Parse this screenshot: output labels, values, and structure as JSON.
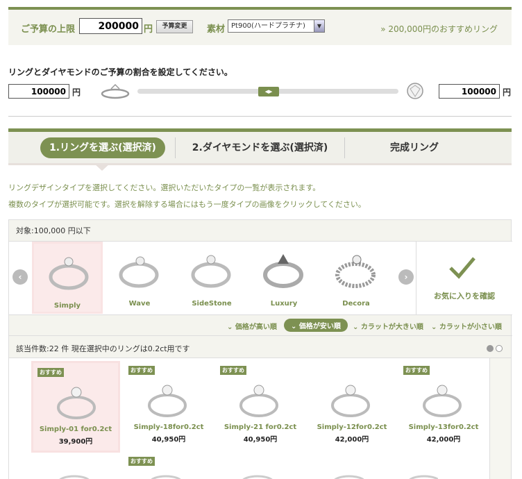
{
  "budget": {
    "label": "ご予算の上限",
    "value": "200000",
    "yen": "円",
    "change_button": "予算変更",
    "material_label": "素材",
    "material_value": "Pt900(ハードプラチナ)",
    "recommend_link": "» 200,000円のおすすめリング"
  },
  "ratio": {
    "title": "リングとダイヤモンドのご予算の割合を設定してください。",
    "ring_amount": "100000",
    "diamond_amount": "100000",
    "yen": "円",
    "ring_share_percent": 50
  },
  "steps": [
    {
      "label": "1.リングを選ぶ(選択済)"
    },
    {
      "label": "2.ダイヤモンドを選ぶ(選択済)"
    },
    {
      "label": "完成リング"
    }
  ],
  "intro": {
    "line1": "リングデザインタイプを選択してください。選択いただいたタイプの一覧が表示されます。",
    "line2": "複数のタイプが選択可能です。選択を解除する場合にはもう一度タイプの画像をクリックしてください。"
  },
  "types": {
    "target_label": "対象:100,000 円以下",
    "items": [
      {
        "name": "Simply"
      },
      {
        "name": "Wave"
      },
      {
        "name": "SideStone"
      },
      {
        "name": "Luxury"
      },
      {
        "name": "Decora"
      }
    ],
    "favorite_label": "お気に入りを確認"
  },
  "sort": {
    "options": [
      "⌄ 価格が高い順",
      "⌄ 価格が安い順",
      "⌄ カラットが大きい順",
      "⌄ カラットが小さい順"
    ]
  },
  "count": {
    "text": "該当件数:22 件  現在選択中のリングは0.2ct用です"
  },
  "products": [
    {
      "badge": "おすすめ",
      "name": "Simply-01 for0.2ct",
      "price": "39,900円"
    },
    {
      "badge": "おすすめ",
      "name": "Simply-18for0.2ct",
      "price": "40,950円"
    },
    {
      "badge": "おすすめ",
      "name": "Simply-21 for0.2ct",
      "price": "40,950円"
    },
    {
      "badge": "",
      "name": "Simply-12for0.2ct",
      "price": "42,000円"
    },
    {
      "badge": "おすすめ",
      "name": "Simply-13for0.2ct",
      "price": "42,000円"
    }
  ],
  "second_row_badge": "おすすめ",
  "colors": {
    "accent": "#7d9152",
    "selected_bg": "#fbeaea"
  }
}
